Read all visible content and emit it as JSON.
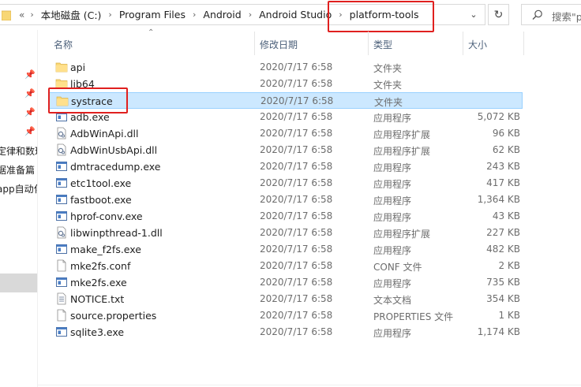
{
  "address_bar": {
    "overflow": "«",
    "crumbs": [
      "本地磁盘 (C:)",
      "Program Files",
      "Android",
      "Android Studio",
      "platform-tools"
    ],
    "refresh_icon": "refresh-icon",
    "dropdown_icon": "chevron-down-icon"
  },
  "search": {
    "placeholder": "搜索\"p"
  },
  "nav": {
    "items": [
      "定律和数理",
      "据准备篇",
      "app自动化"
    ]
  },
  "columns": {
    "name": "名称",
    "date": "修改日期",
    "type": "类型",
    "size": "大小"
  },
  "files": [
    {
      "name": "api",
      "date": "2020/7/17 6:58",
      "type": "文件夹",
      "size": "",
      "icon": "folder"
    },
    {
      "name": "lib64",
      "date": "2020/7/17 6:58",
      "type": "文件夹",
      "size": "",
      "icon": "folder"
    },
    {
      "name": "systrace",
      "date": "2020/7/17 6:58",
      "type": "文件夹",
      "size": "",
      "icon": "folder"
    },
    {
      "name": "adb.exe",
      "date": "2020/7/17 6:58",
      "type": "应用程序",
      "size": "5,072 KB",
      "icon": "exe"
    },
    {
      "name": "AdbWinApi.dll",
      "date": "2020/7/17 6:58",
      "type": "应用程序扩展",
      "size": "96 KB",
      "icon": "dll"
    },
    {
      "name": "AdbWinUsbApi.dll",
      "date": "2020/7/17 6:58",
      "type": "应用程序扩展",
      "size": "62 KB",
      "icon": "dll"
    },
    {
      "name": "dmtracedump.exe",
      "date": "2020/7/17 6:58",
      "type": "应用程序",
      "size": "243 KB",
      "icon": "exe"
    },
    {
      "name": "etc1tool.exe",
      "date": "2020/7/17 6:58",
      "type": "应用程序",
      "size": "417 KB",
      "icon": "exe"
    },
    {
      "name": "fastboot.exe",
      "date": "2020/7/17 6:58",
      "type": "应用程序",
      "size": "1,364 KB",
      "icon": "exe"
    },
    {
      "name": "hprof-conv.exe",
      "date": "2020/7/17 6:58",
      "type": "应用程序",
      "size": "43 KB",
      "icon": "exe"
    },
    {
      "name": "libwinpthread-1.dll",
      "date": "2020/7/17 6:58",
      "type": "应用程序扩展",
      "size": "227 KB",
      "icon": "dll"
    },
    {
      "name": "make_f2fs.exe",
      "date": "2020/7/17 6:58",
      "type": "应用程序",
      "size": "482 KB",
      "icon": "exe"
    },
    {
      "name": "mke2fs.conf",
      "date": "2020/7/17 6:58",
      "type": "CONF 文件",
      "size": "2 KB",
      "icon": "file"
    },
    {
      "name": "mke2fs.exe",
      "date": "2020/7/17 6:58",
      "type": "应用程序",
      "size": "735 KB",
      "icon": "exe"
    },
    {
      "name": "NOTICE.txt",
      "date": "2020/7/17 6:58",
      "type": "文本文档",
      "size": "354 KB",
      "icon": "txt"
    },
    {
      "name": "source.properties",
      "date": "2020/7/17 6:58",
      "type": "PROPERTIES 文件",
      "size": "1 KB",
      "icon": "file"
    },
    {
      "name": "sqlite3.exe",
      "date": "2020/7/17 6:58",
      "type": "应用程序",
      "size": "1,174 KB",
      "icon": "exe"
    }
  ],
  "selected_row": "systrace",
  "colors": {
    "highlight": "#e0201f",
    "selection": "#cce8ff",
    "folder": "#f8d775"
  }
}
